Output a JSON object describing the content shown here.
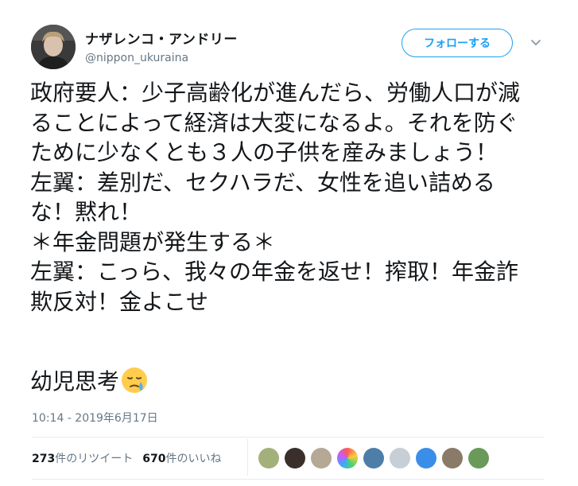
{
  "author": {
    "display_name": "ナザレンコ・アンドリー",
    "username": "@nippon_ukuraina"
  },
  "follow_label": "フォローする",
  "tweet": {
    "body": "政府要人：少子高齢化が進んだら、労働人口が減ることによって経済は大変になるよ。それを防ぐために少なくとも３人の子供を産みましょう！\n左翼：差別だ、セクハラだ、女性を追い詰めるな！黙れ！\n＊年金問題が発生する＊\n左翼：こっら、我々の年金を返せ！搾取！年金詐欺反対！金よこせ",
    "closing": "幼児思考",
    "emoji": "sad-face-icon"
  },
  "timestamp": "10:14 - 2019年6月17日",
  "stats": {
    "retweets_count": "273",
    "retweets_label": "件のリツイート",
    "likes_count": "670",
    "likes_label": "件のいいね"
  },
  "likers": [
    "liker-1",
    "liker-2",
    "liker-3",
    "liker-4",
    "liker-5",
    "liker-6",
    "liker-7",
    "liker-8",
    "liker-9"
  ],
  "colors": {
    "accent": "#1da1f2",
    "text": "#14171a",
    "muted": "#657786",
    "border": "#e6ecf0"
  }
}
